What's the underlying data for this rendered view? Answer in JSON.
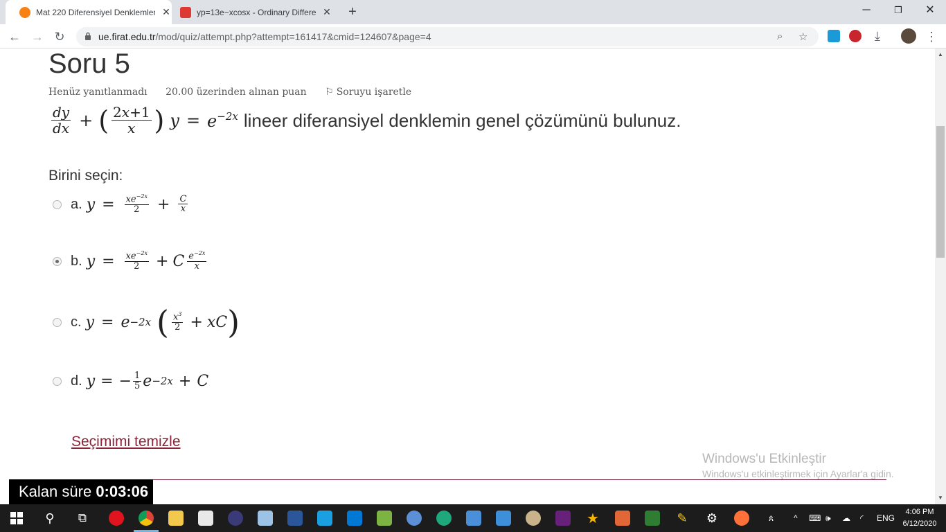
{
  "browser": {
    "tabs": [
      {
        "title": "Mat 220 Diferensiyel Denklemler",
        "active": true,
        "icon": "moodle-icon",
        "color": "#f98012"
      },
      {
        "title": "yp=13e−xcosx - Ordinary Differe",
        "active": false,
        "icon": "symbolab-icon",
        "color": "#dd3a34"
      }
    ],
    "new_tab": "+",
    "url_host": "ue.firat.edu.tr",
    "url_path": "/mod/quiz/attempt.php?attempt=161417&cmid=124607&page=4"
  },
  "question": {
    "title": "Soru 5",
    "status": "Henüz yanıtlanmadı",
    "points": "20.00 üzerinden alınan puan",
    "flag": "Soruyu işaretle",
    "text": "lineer diferansiyel denklemin genel çözümünü bulunuz.",
    "prompt": "Birini seçin:",
    "options": [
      {
        "label": "a.",
        "checked": false
      },
      {
        "label": "b.",
        "checked": true
      },
      {
        "label": "c.",
        "checked": false
      },
      {
        "label": "d.",
        "checked": false
      }
    ],
    "clear": "Seçimimi temizle"
  },
  "watermark": {
    "line1": "Windows'u Etkinleştir",
    "line2": "Windows'u etkinleştirmek için Ayarlar'a gidin."
  },
  "timer": {
    "label": "Kalan süre",
    "value": "0:03:06"
  },
  "taskbar": {
    "lang": "ENG",
    "time": "4:06 PM",
    "date": "6/12/2020"
  },
  "colors": {
    "accent": "#8b2439",
    "taskbar": "#1c1c1c"
  }
}
